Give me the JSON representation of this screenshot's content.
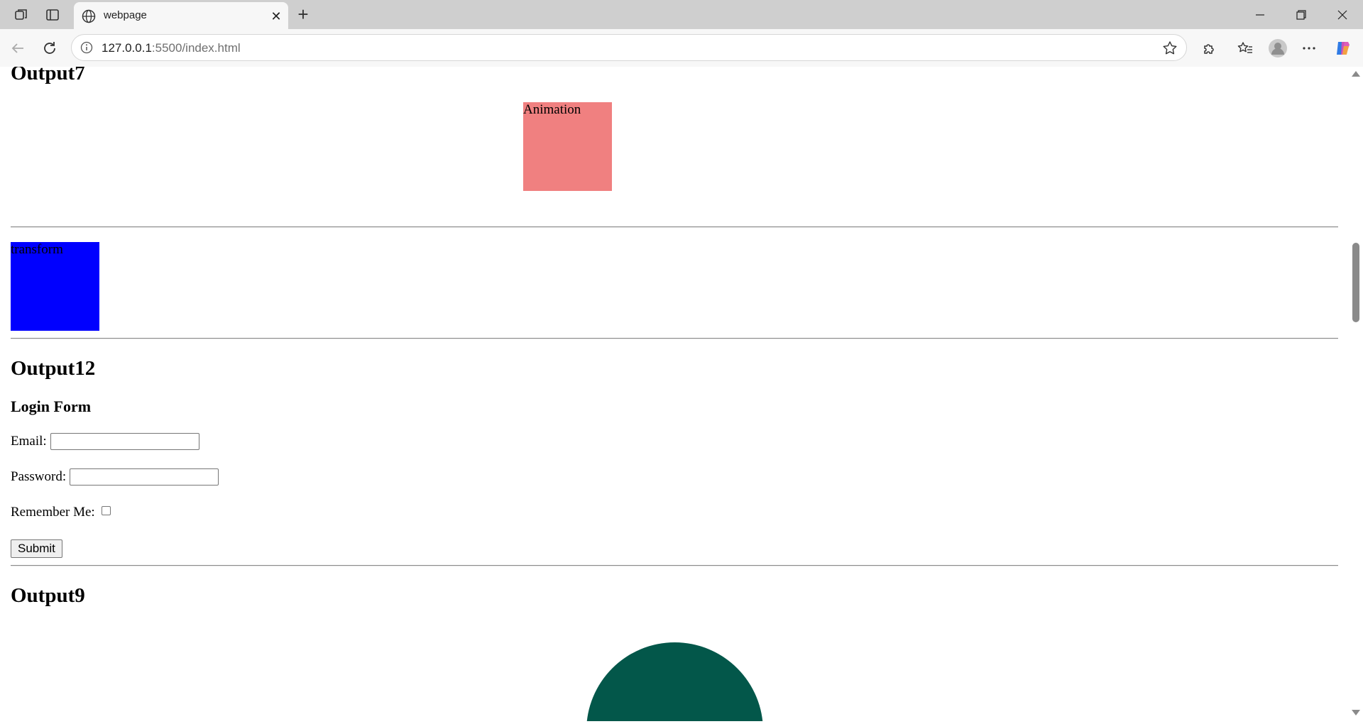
{
  "browser": {
    "tab_title": "webpage",
    "url_host": "127.0.0.1",
    "url_rest": ":5500/index.html"
  },
  "page": {
    "output7_heading": "Output7",
    "animation_label": "Animation",
    "transform_label": "transform",
    "output12_heading": "Output12",
    "login_heading": "Login Form",
    "email_label": "Email:",
    "email_value": "",
    "password_label": "Password:",
    "password_value": "",
    "remember_label": "Remember Me:",
    "remember_checked": false,
    "submit_label": "Submit",
    "output9_heading": "Output9"
  },
  "colors": {
    "animation_box": "#f08080",
    "transform_box": "#0000ff",
    "semicircle": "#03574a"
  }
}
